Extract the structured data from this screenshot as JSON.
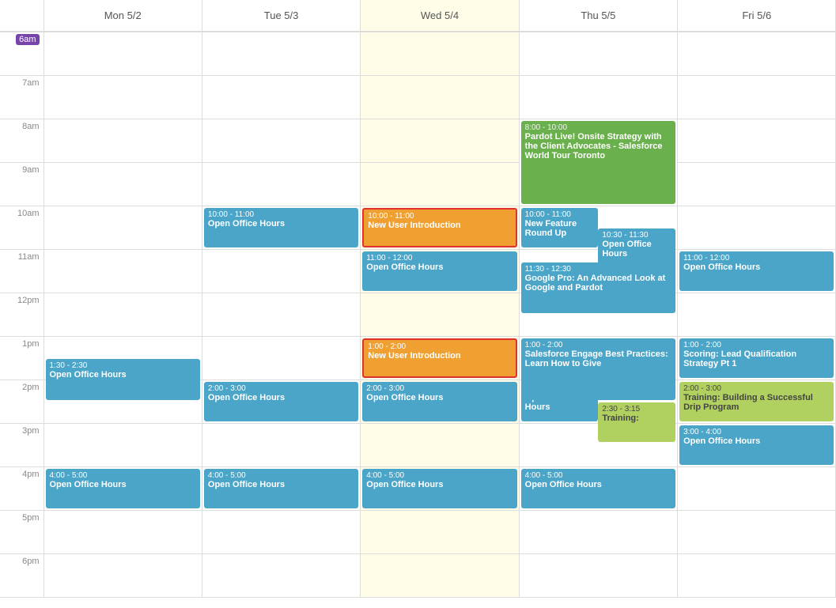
{
  "header": {
    "time_col": "",
    "days": [
      {
        "label": "Mon 5/2"
      },
      {
        "label": "Tue 5/3"
      },
      {
        "label": "Wed 5/4"
      },
      {
        "label": "Thu 5/5"
      },
      {
        "label": "Fri 5/6"
      }
    ]
  },
  "time_slots": [
    {
      "label": "6am"
    },
    {
      "label": "7am"
    },
    {
      "label": "8am"
    },
    {
      "label": "9am"
    },
    {
      "label": "10am"
    },
    {
      "label": "11am"
    },
    {
      "label": "12pm"
    },
    {
      "label": "1pm"
    },
    {
      "label": "2pm"
    },
    {
      "label": "3pm"
    },
    {
      "label": "4pm"
    },
    {
      "label": "5pm"
    },
    {
      "label": "6pm"
    }
  ],
  "events": {
    "mon": [
      {
        "time": "1:30 - 2:30",
        "title": "Open Office Hours",
        "color": "blue",
        "top": 0,
        "height": 55
      },
      {
        "time": "4:00 - 5:00",
        "title": "Open Office Hours",
        "color": "blue",
        "top": 0,
        "height": 55
      }
    ],
    "tue": [
      {
        "time": "10:00 - 11:00",
        "title": "Open Office Hours",
        "color": "blue"
      },
      {
        "time": "2:00 - 3:00",
        "title": "Open Office Hours",
        "color": "blue"
      },
      {
        "time": "4:00 - 5:00",
        "title": "Open Office Hours",
        "color": "blue"
      }
    ],
    "wed": [
      {
        "time": "10:00 - 11:00",
        "title": "New User Introduction",
        "color": "orange"
      },
      {
        "time": "11:00 - 12:00",
        "title": "Open Office Hours",
        "color": "blue"
      },
      {
        "time": "1:00 - 2:00",
        "title": "New User Introduction",
        "color": "orange"
      },
      {
        "time": "2:00 - 3:00",
        "title": "Open Office Hours",
        "color": "blue"
      },
      {
        "time": "4:00 - 5:00",
        "title": "Open Office Hours",
        "color": "blue"
      }
    ],
    "thu": [
      {
        "time": "8:00 - 10:00",
        "title": "Pardot Live! Onsite Strategy with the Client Advocates - Salesforce World Tour Toronto",
        "color": "green"
      },
      {
        "time": "10:00 - 11:00",
        "title": "New Feature Round Up",
        "color": "blue"
      },
      {
        "time": "10:30 - 11:30",
        "title": "Open Office Hours",
        "color": "blue"
      },
      {
        "time": "11:30 - 12:30",
        "title": "Google Pro: An Advanced Look at Google and Pardot",
        "color": "blue"
      },
      {
        "time": "1:00 - 2:00",
        "title": "Salesforce Engage Best Practices: Learn How to Give",
        "color": "blue"
      },
      {
        "time": "2:00 - 3:00",
        "title": "Open Office Hours",
        "color": "blue"
      },
      {
        "time": "2:30 - 3:15",
        "title": "Training:",
        "color": "light-green"
      },
      {
        "time": "4:00 - 5:00",
        "title": "Open Office Hours",
        "color": "blue"
      }
    ],
    "fri": [
      {
        "time": "11:00 - 12:00",
        "title": "Open Office Hours",
        "color": "blue"
      },
      {
        "time": "1:00 - 2:00",
        "title": "Scoring: Lead Qualification Strategy Pt 1",
        "color": "blue"
      },
      {
        "time": "2:00 - 3:00",
        "title": "Training: Building a Successful Drip Program",
        "color": "light-green"
      },
      {
        "time": "3:00 - 4:00",
        "title": "Open Office Hours",
        "color": "blue"
      }
    ]
  }
}
